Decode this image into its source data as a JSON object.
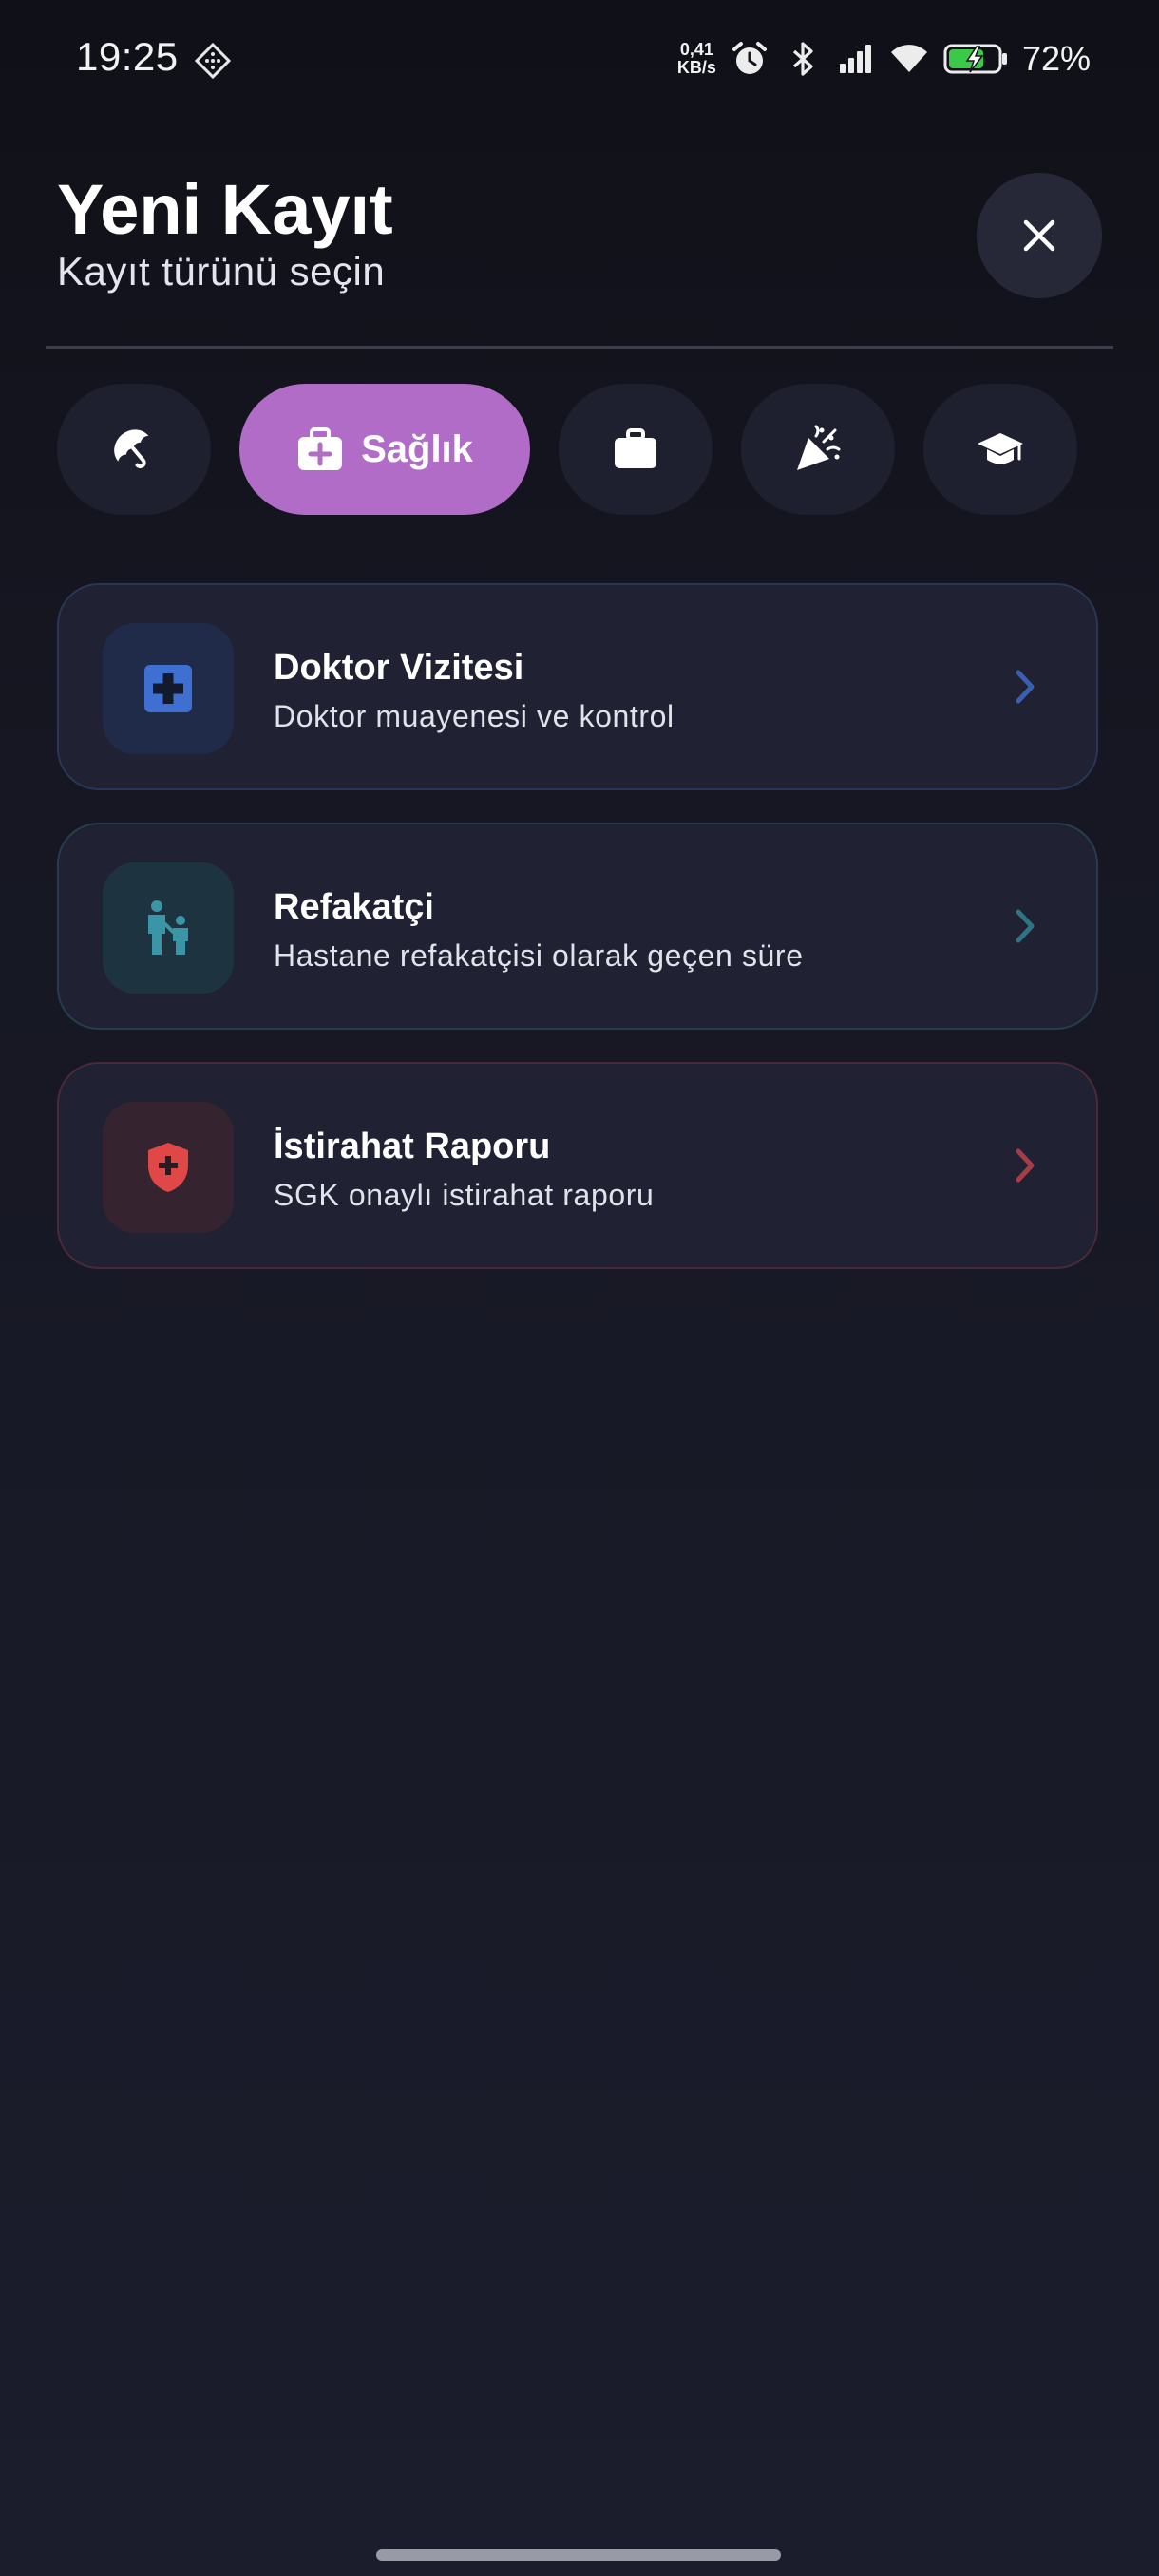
{
  "status_bar": {
    "time": "19:25",
    "net_speed_value": "0,41",
    "net_speed_unit": "KB/s",
    "battery_percent": "72%",
    "icons": [
      "app-notification-icon",
      "alarm-icon",
      "bluetooth-icon",
      "signal-icon",
      "wifi-icon",
      "battery-charging-icon"
    ]
  },
  "header": {
    "title": "Yeni Kayıt",
    "subtitle": "Kayıt türünü seçin",
    "close_icon": "close-icon"
  },
  "categories": [
    {
      "icon": "umbrella-icon",
      "label": "",
      "active": false
    },
    {
      "icon": "medical-kit-icon",
      "label": "Sağlık",
      "active": true
    },
    {
      "icon": "briefcase-icon",
      "label": "",
      "active": false
    },
    {
      "icon": "party-popper-icon",
      "label": "",
      "active": false
    },
    {
      "icon": "graduation-cap-icon",
      "label": "",
      "active": false
    }
  ],
  "records": [
    {
      "title": "Doktor Vizitesi",
      "description": "Doktor muayenesi ve kontrol",
      "icon": "medical-cross-icon",
      "accent": "#3f6fd0"
    },
    {
      "title": "Refakatçi",
      "description": "Hastane refakatçisi olarak geçen süre",
      "icon": "parent-child-icon",
      "accent": "#3a96a6"
    },
    {
      "title": "İstirahat Raporu",
      "description": "SGK onaylı istirahat raporu",
      "icon": "shield-cross-icon",
      "accent": "#e04848"
    }
  ],
  "colors": {
    "background": "#161722",
    "chip_active": "#b06cc6",
    "chip_inactive": "#1e2030",
    "card": "#202233"
  }
}
